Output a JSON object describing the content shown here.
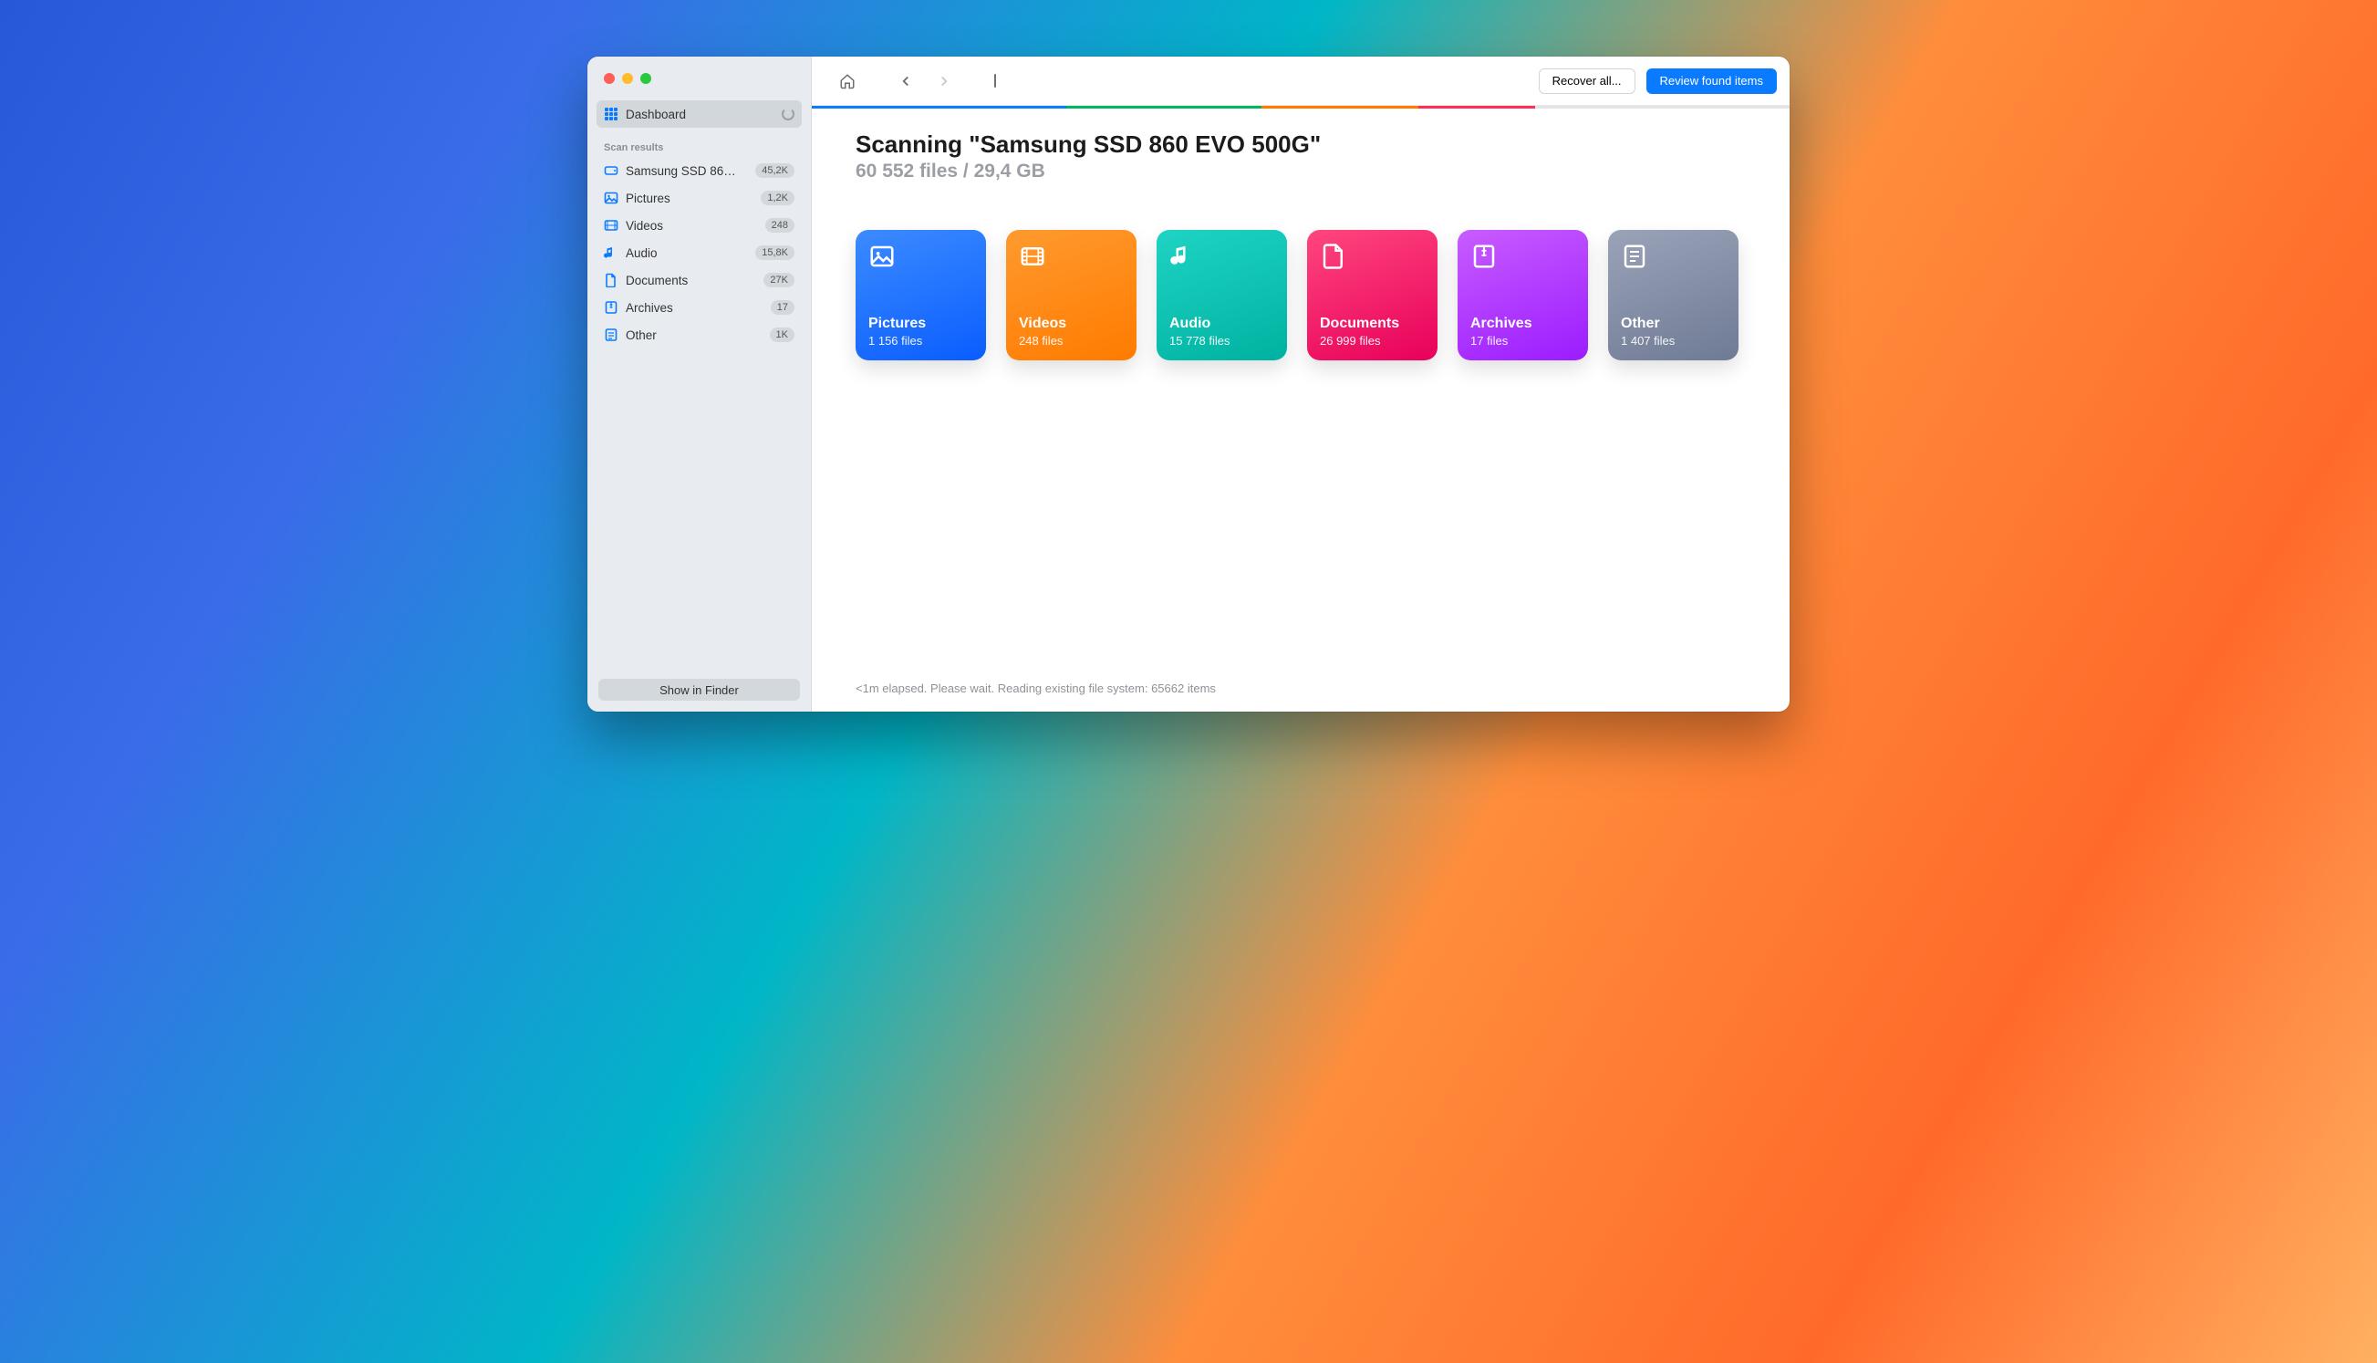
{
  "sidebar": {
    "dashboard_label": "Dashboard",
    "section_title": "Scan results",
    "items": [
      {
        "id": "drive",
        "label": "Samsung SSD 86…",
        "count": "45,2K",
        "icon": "drive"
      },
      {
        "id": "pictures",
        "label": "Pictures",
        "count": "1,2K",
        "icon": "picture"
      },
      {
        "id": "videos",
        "label": "Videos",
        "count": "248",
        "icon": "video"
      },
      {
        "id": "audio",
        "label": "Audio",
        "count": "15,8K",
        "icon": "audio"
      },
      {
        "id": "documents",
        "label": "Documents",
        "count": "27K",
        "icon": "document"
      },
      {
        "id": "archives",
        "label": "Archives",
        "count": "17",
        "icon": "archive"
      },
      {
        "id": "other",
        "label": "Other",
        "count": "1K",
        "icon": "other"
      }
    ],
    "footer_button": "Show in Finder"
  },
  "toolbar": {
    "recover_label": "Recover all...",
    "review_label": "Review found items"
  },
  "progress_segments": [
    {
      "color": "#0a7bff",
      "width": "26%"
    },
    {
      "color": "#00b764",
      "width": "20%"
    },
    {
      "color": "#ff7b00",
      "width": "16%"
    },
    {
      "color": "#ff2d55",
      "width": "12%"
    },
    {
      "color": "#e5e5e5",
      "width": "26%"
    }
  ],
  "heading": {
    "title": "Scanning \"Samsung SSD 860 EVO 500G\"",
    "subtitle": "60 552 files / 29,4 GB"
  },
  "cards": [
    {
      "id": "pictures",
      "class": "c-pictures",
      "title": "Pictures",
      "sub": "1 156 files",
      "icon": "picture"
    },
    {
      "id": "videos",
      "class": "c-videos",
      "title": "Videos",
      "sub": "248 files",
      "icon": "video"
    },
    {
      "id": "audio",
      "class": "c-audio",
      "title": "Audio",
      "sub": "15 778 files",
      "icon": "audio"
    },
    {
      "id": "documents",
      "class": "c-documents",
      "title": "Documents",
      "sub": "26 999 files",
      "icon": "document"
    },
    {
      "id": "archives",
      "class": "c-archives",
      "title": "Archives",
      "sub": "17 files",
      "icon": "archive"
    },
    {
      "id": "other",
      "class": "c-other",
      "title": "Other",
      "sub": "1 407 files",
      "icon": "other"
    }
  ],
  "status_text": "<1m elapsed. Please wait. Reading existing file system: 65662 items"
}
